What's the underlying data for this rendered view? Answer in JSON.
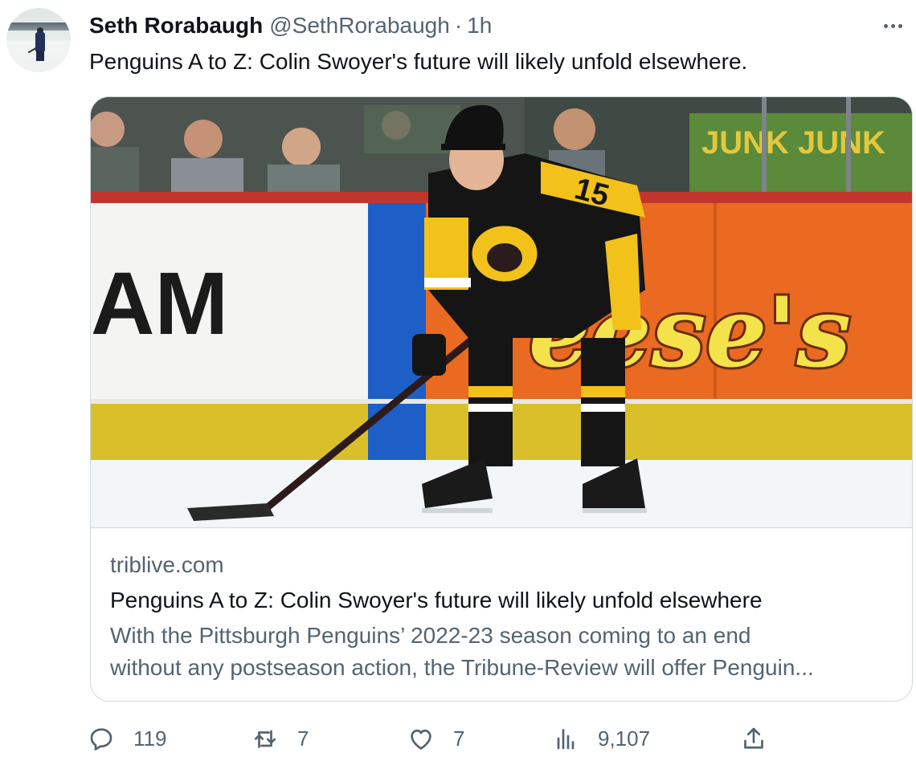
{
  "tweet": {
    "author_name": "Seth Rorabaugh",
    "author_handle": "@SethRorabaugh",
    "separator": "·",
    "time": "1h",
    "text": "Penguins A to Z: Colin Swoyer's future will likely unfold elsewhere."
  },
  "card": {
    "domain": "triblive.com",
    "title": "Penguins A to Z: Colin Swoyer's future will likely unfold elsewhere",
    "description_line1": "With the Pittsburgh Penguins’ 2022-23 season coming to an end",
    "description_line2": "without any postseason action, the Tribune-Review will offer Penguin...",
    "image": {
      "jersey_number": "15",
      "board_text_left": "AM",
      "board_text_right": "eese's",
      "glass_sign": "JUNK"
    }
  },
  "actions": {
    "replies": "119",
    "reposts": "7",
    "likes": "7",
    "views": "9,107"
  },
  "icons": {
    "more": "more-horizontal-icon",
    "reply": "reply-icon",
    "repost": "repost-icon",
    "like": "heart-icon",
    "views": "views-chart-icon",
    "share": "share-icon"
  },
  "colors": {
    "text": "#0f1419",
    "secondary": "#536471",
    "border": "#cfd9de",
    "jersey_gold": "#f2c11a"
  }
}
